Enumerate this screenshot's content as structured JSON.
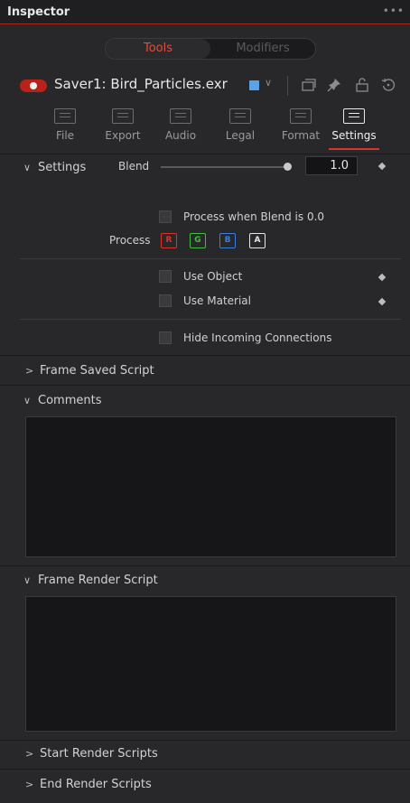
{
  "window": {
    "title": "Inspector",
    "more_glyph": "•••"
  },
  "segments": [
    {
      "label": "Tools",
      "active": true
    },
    {
      "label": "Modifiers",
      "active": false
    }
  ],
  "tool": {
    "name": "Saver1: Bird_Particles.exr",
    "enabled": true,
    "color_swatch": "#5aa3e6"
  },
  "header_icons": [
    "chevron-down-icon",
    "stack-icon",
    "pin-icon",
    "lock-icon",
    "reset-icon"
  ],
  "tabs": [
    {
      "label": "File",
      "active": false
    },
    {
      "label": "Export",
      "active": false
    },
    {
      "label": "Audio",
      "active": false
    },
    {
      "label": "Legal",
      "active": false
    },
    {
      "label": "Format",
      "active": false
    },
    {
      "label": "Settings",
      "active": true
    }
  ],
  "settings": {
    "section_label": "Settings",
    "expanded": true,
    "blend_label": "Blend",
    "blend_value": "1.0",
    "blend_fraction": 1.0,
    "process_blend_zero_label": "Process when Blend is 0.0",
    "process_label": "Process",
    "channels": [
      {
        "label": "R",
        "color": "#d8342a"
      },
      {
        "label": "G",
        "color": "#3fbf3f"
      },
      {
        "label": "B",
        "color": "#3a7fe0"
      },
      {
        "label": "A",
        "color": "#e6e6e6"
      }
    ],
    "use_object_label": "Use Object",
    "use_material_label": "Use Material",
    "hide_incoming_label": "Hide Incoming Connections"
  },
  "sections": {
    "frame_saved_script": "Frame Saved Script",
    "comments": "Comments",
    "frame_render_script": "Frame Render Script",
    "start_render_scripts": "Start Render Scripts",
    "end_render_scripts": "End Render Scripts"
  },
  "colors": {
    "accent": "#d8342a",
    "background": "#28282b",
    "active_tab_underline": "#d8342a"
  }
}
